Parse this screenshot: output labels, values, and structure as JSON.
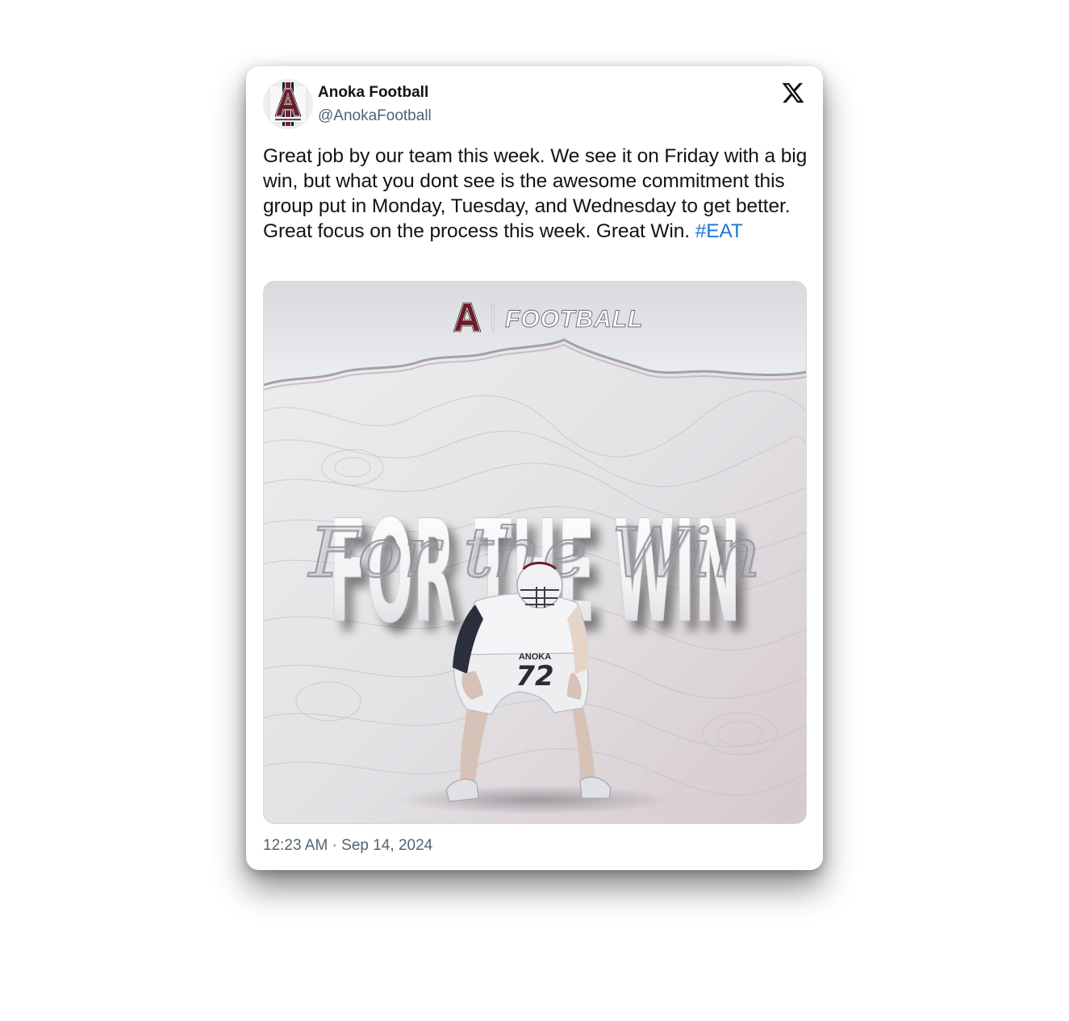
{
  "account": {
    "display_name": "Anoka Football",
    "handle": "@AnokaFootball"
  },
  "tweet": {
    "text": "Great job by our team this week. We see it on Friday with a big win, but what you dont see is the awesome commitment this group put in Monday, Tuesday, and Wednesday to get better. Great focus on the process this week. Great Win. ",
    "hashtag": "#EAT",
    "time": "12:23 AM",
    "separator": " · ",
    "date": "Sep 14, 2024"
  },
  "media": {
    "logo_letter": "A",
    "brand_label": "FOOTBALL",
    "headline": "FOR THE WIN",
    "script_overlay": "For the Win",
    "jersey_name": "ANOKA",
    "jersey_number": "72"
  },
  "icons": {
    "platform": "x-logo-icon"
  },
  "colors": {
    "hashtag": "#1d77d3",
    "brand_maroon": "#6e1b2c",
    "text_primary": "#0f1419",
    "text_secondary": "#536471"
  }
}
